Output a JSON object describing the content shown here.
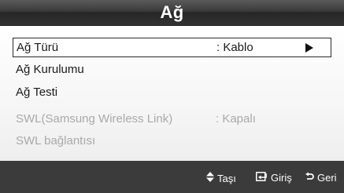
{
  "window": {
    "title": "Ağ"
  },
  "menu": {
    "items": [
      {
        "label": "Ağ Türü",
        "value": ": Kablo",
        "selected": true,
        "enabled": true,
        "has_submenu": true
      },
      {
        "label": "Ağ Kurulumu",
        "value": "",
        "selected": false,
        "enabled": true
      },
      {
        "label": "Ağ Testi",
        "value": "",
        "selected": false,
        "enabled": true
      },
      {
        "label": "SWL(Samsung Wireless Link)",
        "value": ": Kapalı",
        "selected": false,
        "enabled": false
      },
      {
        "label": "SWL bağlantısı",
        "value": "",
        "selected": false,
        "enabled": false
      }
    ]
  },
  "footer": {
    "hints": [
      {
        "icon": "up-down-arrows-icon",
        "label": "Taşı"
      },
      {
        "icon": "enter-icon",
        "label": "Giriş"
      },
      {
        "icon": "return-icon",
        "label": "Geri"
      }
    ]
  },
  "colors": {
    "title_bar": "#333333",
    "footer_bar": "#3b3b3b",
    "disabled_text": "#a9a9a9"
  }
}
